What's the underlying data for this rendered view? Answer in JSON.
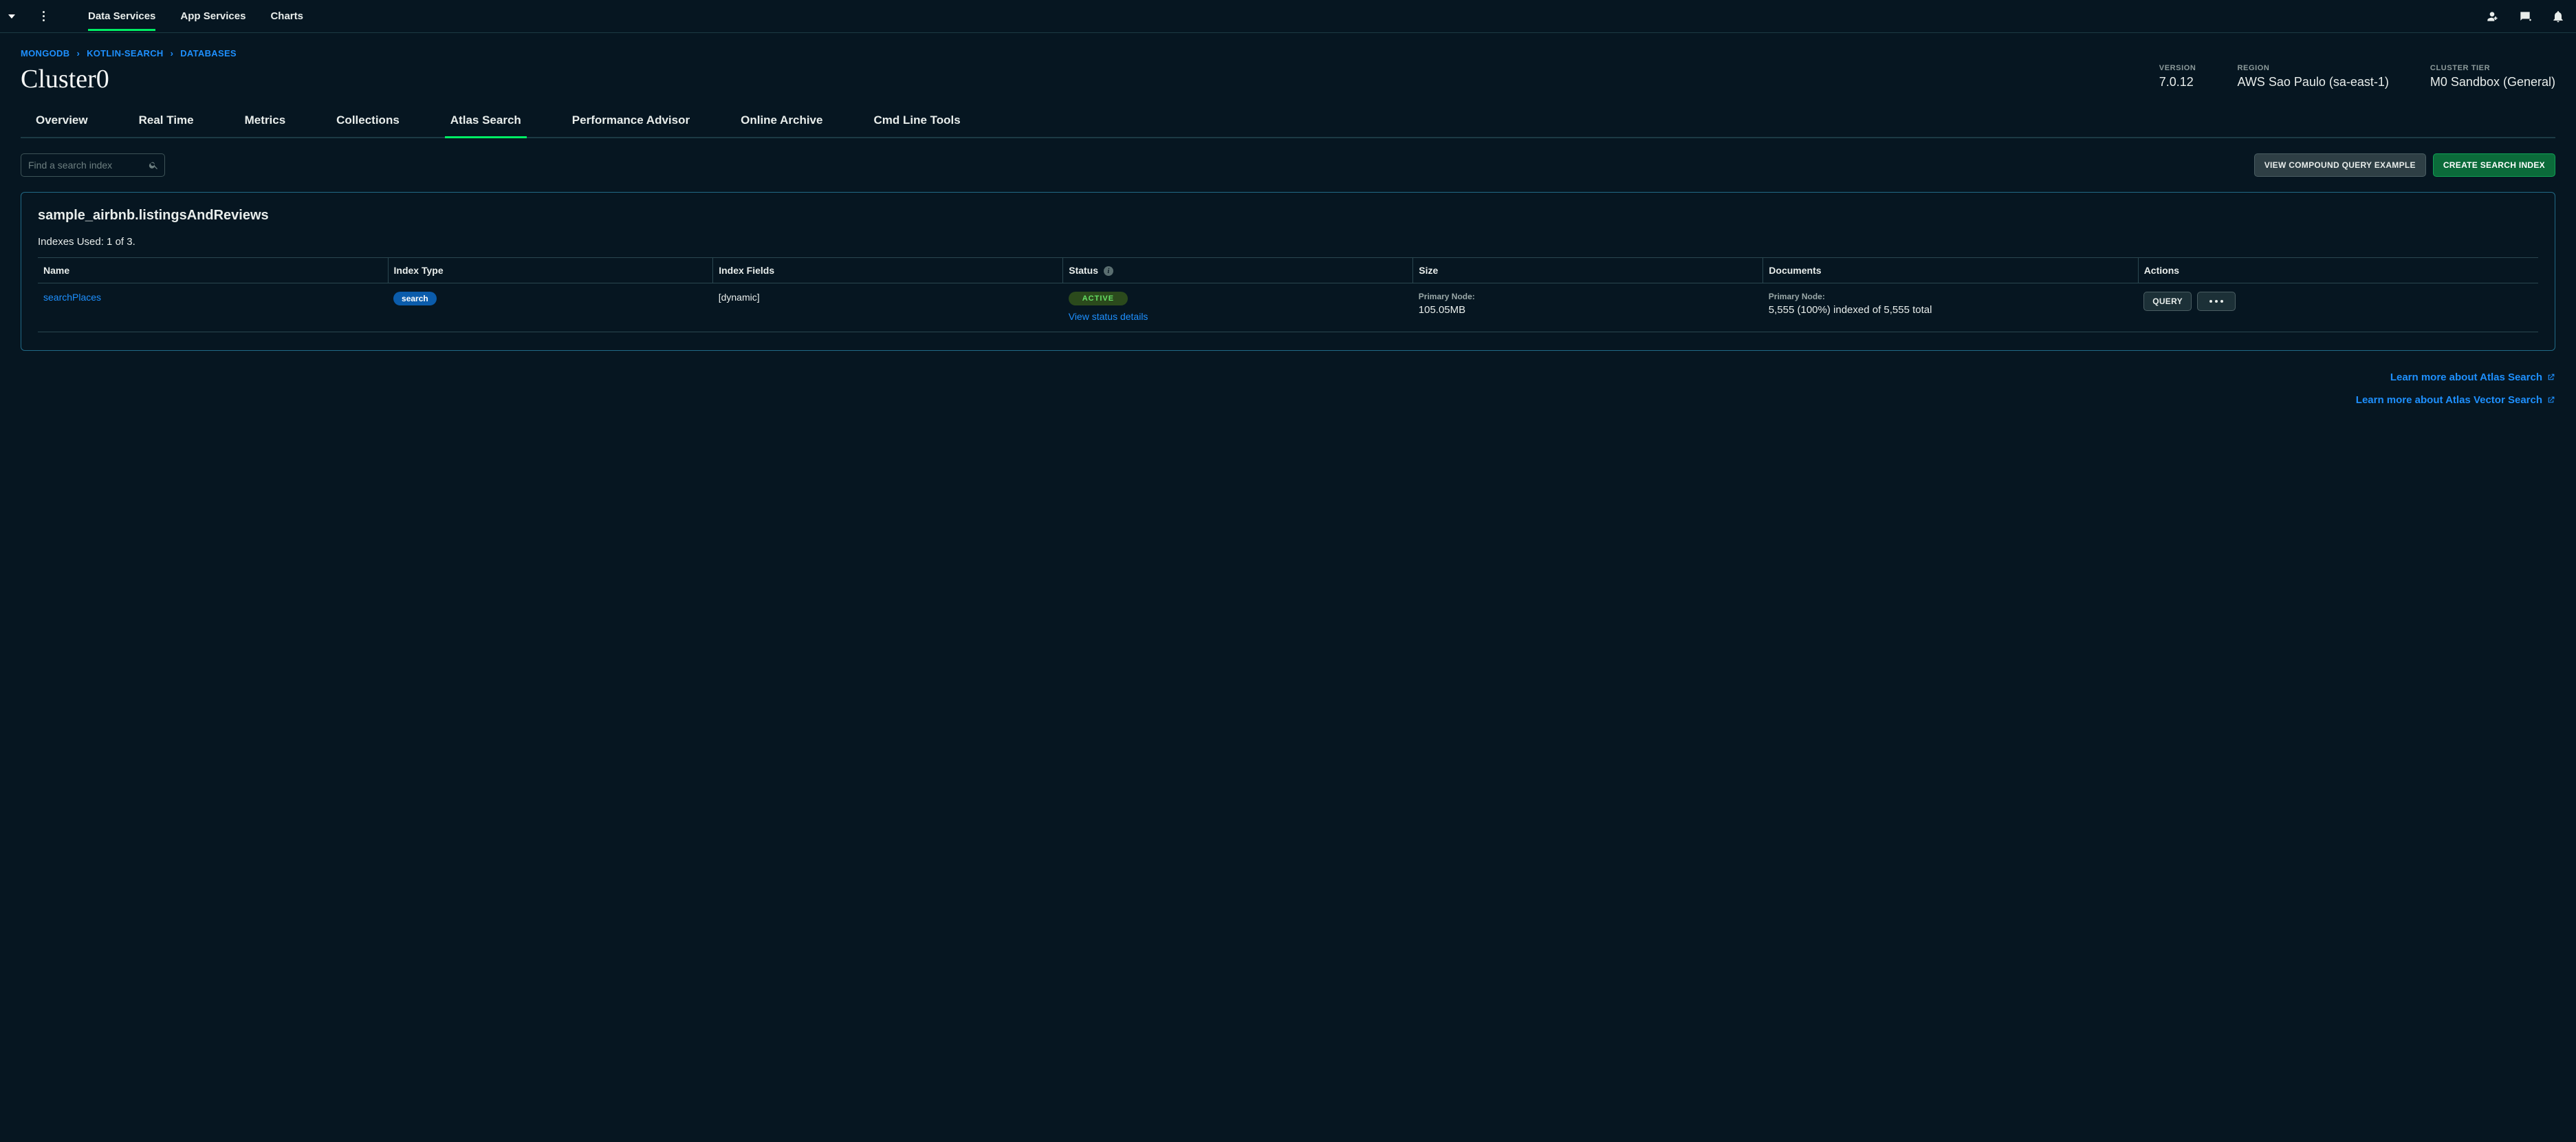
{
  "topnav": {
    "tabs": [
      {
        "label": "Data Services",
        "active": true
      },
      {
        "label": "App Services",
        "active": false
      },
      {
        "label": "Charts",
        "active": false
      }
    ]
  },
  "breadcrumb": {
    "items": [
      "MONGODB",
      "KOTLIN-SEARCH",
      "DATABASES"
    ]
  },
  "cluster": {
    "name": "Cluster0",
    "meta": {
      "version_label": "VERSION",
      "version_value": "7.0.12",
      "region_label": "REGION",
      "region_value": "AWS Sao Paulo (sa-east-1)",
      "tier_label": "CLUSTER TIER",
      "tier_value": "M0 Sandbox (General)"
    }
  },
  "subtabs": [
    {
      "label": "Overview",
      "active": false
    },
    {
      "label": "Real Time",
      "active": false
    },
    {
      "label": "Metrics",
      "active": false
    },
    {
      "label": "Collections",
      "active": false
    },
    {
      "label": "Atlas Search",
      "active": true
    },
    {
      "label": "Performance Advisor",
      "active": false
    },
    {
      "label": "Online Archive",
      "active": false
    },
    {
      "label": "Cmd Line Tools",
      "active": false
    }
  ],
  "search": {
    "placeholder": "Find a search index"
  },
  "buttons": {
    "view_compound": "VIEW COMPOUND QUERY EXAMPLE",
    "create_index": "CREATE SEARCH INDEX",
    "query": "QUERY"
  },
  "panel": {
    "title": "sample_airbnb.listingsAndReviews",
    "indexes_used": "Indexes Used: 1 of 3."
  },
  "table": {
    "headers": {
      "name": "Name",
      "index_type": "Index Type",
      "index_fields": "Index Fields",
      "status": "Status",
      "size": "Size",
      "documents": "Documents",
      "actions": "Actions"
    },
    "row": {
      "name": "searchPlaces",
      "index_type_badge": "search",
      "index_fields": "[dynamic]",
      "status_badge": "ACTIVE",
      "status_link": "View status details",
      "size_label": "Primary Node:",
      "size_value": "105.05MB",
      "docs_label": "Primary Node:",
      "docs_value": "5,555 (100%) indexed of 5,555 total"
    }
  },
  "footer": {
    "link1": "Learn more about Atlas Search",
    "link2": "Learn more about Atlas Vector Search"
  }
}
